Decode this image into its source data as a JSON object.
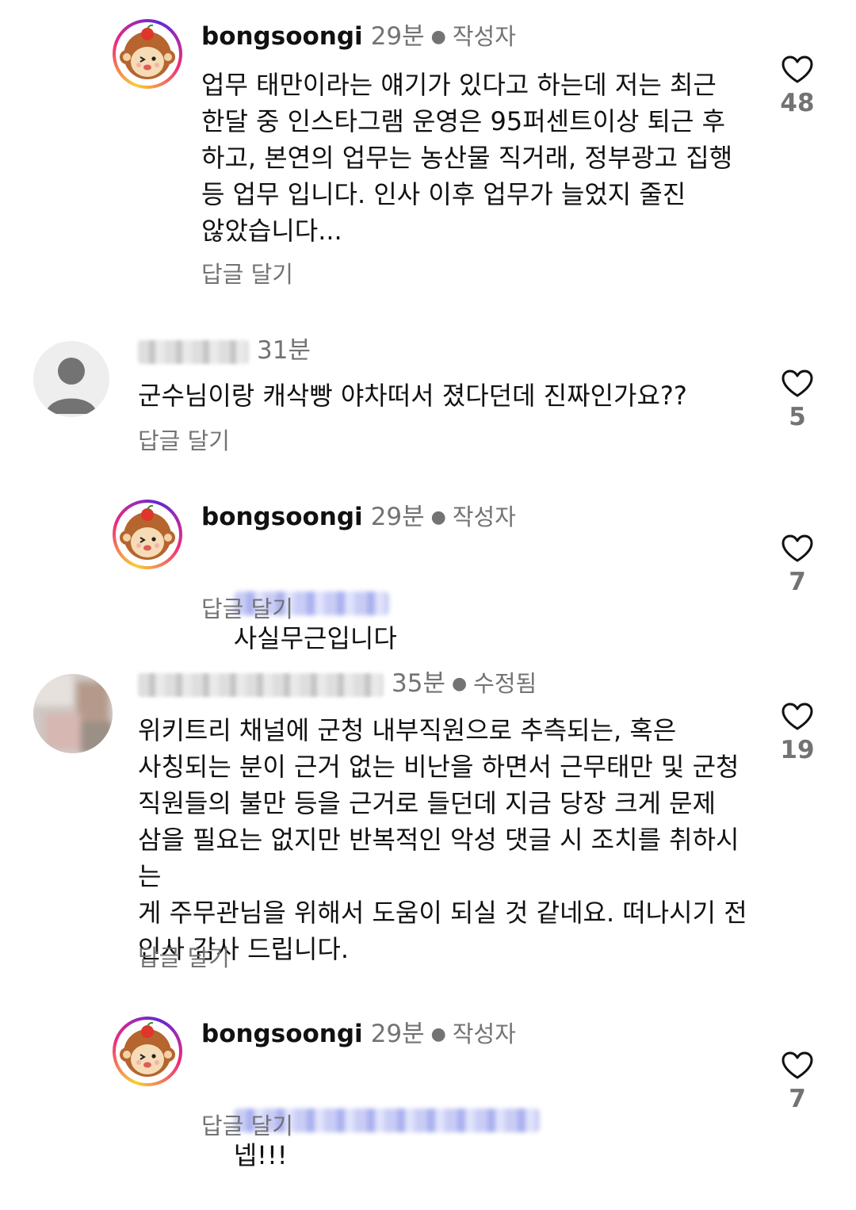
{
  "comments": [
    {
      "username": "bongsoongi",
      "time": "29분",
      "tag": "작성자",
      "text": "업무 태만이라는 얘기가 있다고 하는데 저는 최근\n한달 중 인스타그램 운영은 95퍼센트이상 퇴근 후\n하고, 본연의 업무는 농산물 직거래, 정부광고 집행\n등 업무 입니다. 인사 이후 업무가 늘었지 줄진\n않았습니다...",
      "reply_label": "답글 달기",
      "likes": "48"
    },
    {
      "time": "31분",
      "text": "군수님이랑 캐삭빵 야차떠서 졌다던데 진짜인가요??",
      "reply_label": "답글 달기",
      "likes": "5"
    },
    {
      "username": "bongsoongi",
      "time": "29분",
      "tag": "작성자",
      "text": "사실무근입니다",
      "reply_label": "답글 달기",
      "likes": "7"
    },
    {
      "time": "35분",
      "tag": "수정됨",
      "text": "위키트리 채널에 군청 내부직원으로 추측되는, 혹은\n사칭되는 분이 근거 없는 비난을 하면서 근무태만 및 군청\n직원들의 불만 등을 근거로 들던데 지금 당장 크게 문제\n삼을 필요는 없지만 반복적인 악성 댓글 시 조치를 취하시는\n게 주무관님을 위해서 도움이 되실 것 같네요. 떠나시기 전\n인사 감사 드립니다.",
      "reply_label": "답글 달기",
      "likes": "19"
    },
    {
      "username": "bongsoongi",
      "time": "29분",
      "tag": "작성자",
      "text": "넵!!!",
      "reply_label": "답글 달기",
      "likes": "7"
    }
  ],
  "icons": {
    "like": "heart-outline-icon",
    "avatar_author": "monkey-mascot-icon",
    "avatar_default": "default-user-icon"
  },
  "colors": {
    "text": "#111111",
    "secondary": "#737373",
    "mention_blur": "#aab0ee"
  }
}
